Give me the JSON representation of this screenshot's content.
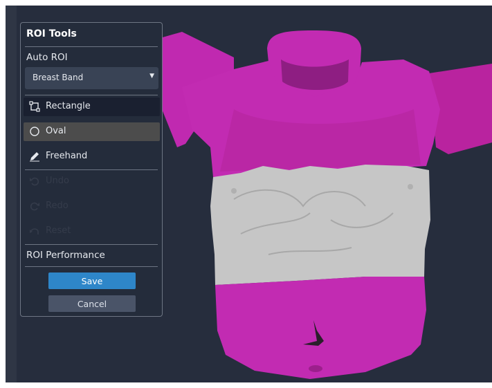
{
  "panel": {
    "title": "ROI Tools",
    "auto_roi_label": "Auto ROI",
    "auto_roi_dropdown": {
      "selected": "Breast Band"
    },
    "tools": {
      "rectangle": "Rectangle",
      "oval": "Oval",
      "freehand": "Freehand",
      "undo": "Undo",
      "redo": "Redo",
      "reset": "Reset"
    },
    "performance_label": "ROI Performance",
    "save_label": "Save",
    "cancel_label": "Cancel"
  },
  "colors": {
    "viewport_bg": "#262d3d",
    "panel_bg": "#242c3b",
    "torso_magenta": "#c029b0",
    "roi_band_gray": "#c2c2c2",
    "save_button": "#2e86c9",
    "selected_tool": "#4c4c4c"
  }
}
